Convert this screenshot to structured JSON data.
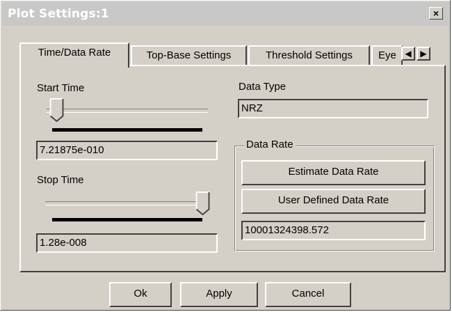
{
  "window": {
    "title": "Plot Settings:1",
    "close_label": "×"
  },
  "tabs": [
    {
      "label": "Time/Data Rate",
      "active": true
    },
    {
      "label": "Top-Base Settings",
      "active": false
    },
    {
      "label": "Threshold Settings",
      "active": false
    },
    {
      "label": "Eye",
      "active": false
    }
  ],
  "tab_scroll": {
    "left_arrow": "◀",
    "right_arrow": "▶"
  },
  "start_time": {
    "label": "Start Time",
    "value": "7.21875e-010",
    "slider_position": 0.06
  },
  "stop_time": {
    "label": "Stop Time",
    "value": "1.28e-008",
    "slider_position": 1.0
  },
  "data_type": {
    "label": "Data Type",
    "value": "NRZ"
  },
  "data_rate": {
    "group_label": "Data Rate",
    "estimate_button": "Estimate Data Rate",
    "user_defined_button": "User Defined Data Rate",
    "value": "10001324398.572"
  },
  "footer": {
    "ok": "Ok",
    "apply": "Apply",
    "cancel": "Cancel"
  },
  "colors": {
    "face": "#d4d0c8",
    "titlebar": "#c8c8c8",
    "title_text": "#ffffff"
  }
}
